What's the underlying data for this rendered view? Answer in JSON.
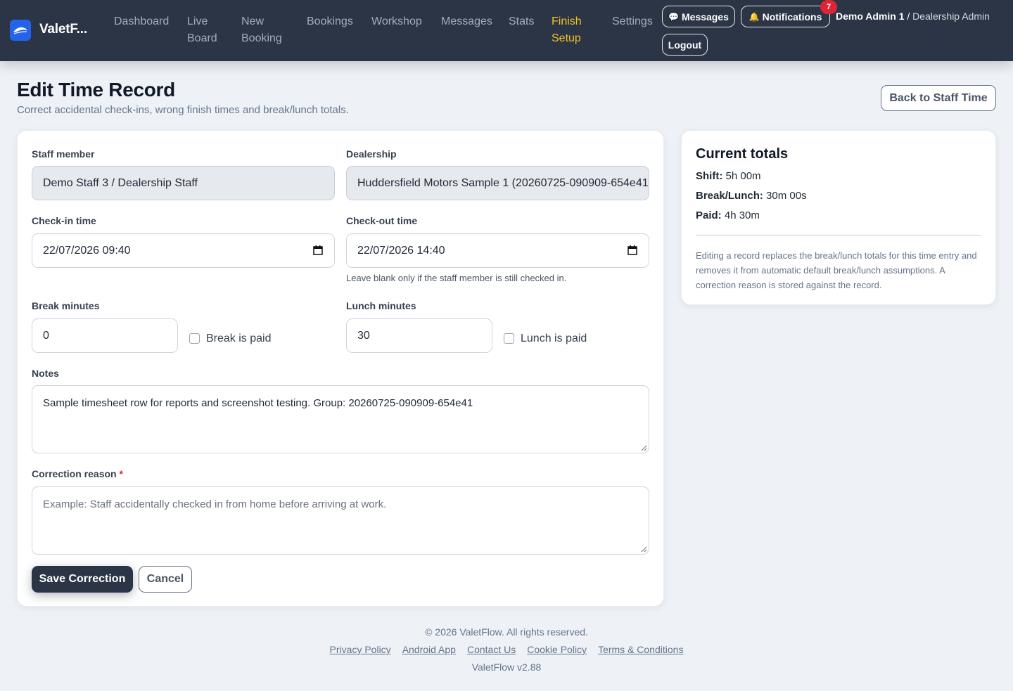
{
  "brand": {
    "name": "ValetF..."
  },
  "nav": {
    "links": [
      {
        "line1": "Dashboard",
        "line2": ""
      },
      {
        "line1": "Live",
        "line2": "Board"
      },
      {
        "line1": "New",
        "line2": "Booking"
      },
      {
        "line1": "Bookings",
        "line2": ""
      },
      {
        "line1": "Workshop",
        "line2": ""
      },
      {
        "line1": "Messages",
        "line2": ""
      },
      {
        "line1": "Stats",
        "line2": ""
      },
      {
        "line1": "Finish",
        "line2": "Setup"
      },
      {
        "line1": "Settings",
        "line2": ""
      }
    ],
    "messages_label": "Messages",
    "notifications_label": "Notifications",
    "notifications_count": "7",
    "user_name": "Demo Admin 1",
    "user_separator": " / ",
    "user_role": "Dealership Admin",
    "logout_label": "Logout"
  },
  "header": {
    "title": "Edit Time Record",
    "subtitle": "Correct accidental check-ins, wrong finish times and break/lunch totals.",
    "back_label": "Back to Staff Time"
  },
  "form": {
    "staff_label": "Staff member",
    "staff_value": "Demo Staff 3 / Dealership Staff",
    "dealership_label": "Dealership",
    "dealership_value": "Huddersfield Motors Sample 1 (20260725-090909-654e41)",
    "checkin_label": "Check-in time",
    "checkin_value": "22/07/2026 09:40",
    "checkout_label": "Check-out time",
    "checkout_value": "22/07/2026 14:40",
    "checkout_help": "Leave blank only if the staff member is still checked in.",
    "break_label": "Break minutes",
    "break_value": "0",
    "break_paid_label": "Break is paid",
    "lunch_label": "Lunch minutes",
    "lunch_value": "30",
    "lunch_paid_label": "Lunch is paid",
    "notes_label": "Notes",
    "notes_value": "Sample timesheet row for reports and screenshot testing. Group: 20260725-090909-654e41",
    "reason_label": "Correction reason",
    "reason_required_mark": "*",
    "reason_placeholder": "Example: Staff accidentally checked in from home before arriving at work.",
    "save_label": "Save Correction",
    "cancel_label": "Cancel"
  },
  "totals": {
    "title": "Current totals",
    "shift_label": "Shift:",
    "shift_value": "5h 00m",
    "break_label": "Break/Lunch:",
    "break_value": "30m 00s",
    "paid_label": "Paid:",
    "paid_value": "4h 30m",
    "note": "Editing a record replaces the break/lunch totals for this time entry and removes it from automatic default break/lunch assumptions. A correction reason is stored against the record."
  },
  "footer": {
    "copyright": "© 2026 ValetFlow. All rights reserved.",
    "links": [
      "Privacy Policy",
      "Android App",
      "Contact Us",
      "Cookie Policy",
      "Terms & Conditions"
    ],
    "version": "ValetFlow v2.88"
  },
  "colors": {
    "navbar": "#2b3545",
    "active_nav": "#f5c028",
    "accent_blue": "#2563eb",
    "badge_red": "#dc2637",
    "page_bg": "#eef2f7"
  }
}
